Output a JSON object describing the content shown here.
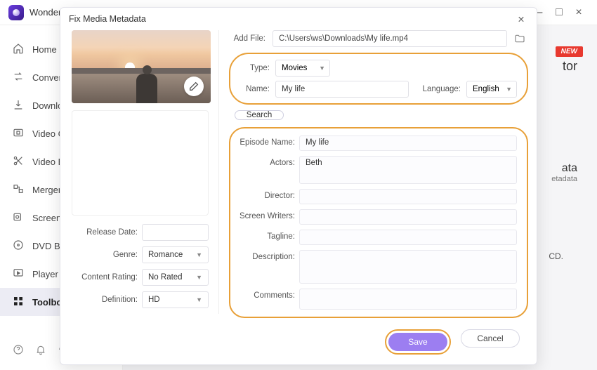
{
  "app": {
    "title_fragment": "Wonder"
  },
  "window_controls": {
    "min": "–",
    "max": "□",
    "close": "×"
  },
  "sidebar": {
    "items": [
      {
        "label": "Home"
      },
      {
        "label": "Converter"
      },
      {
        "label": "Downloader"
      },
      {
        "label": "Video Compressor"
      },
      {
        "label": "Video Editor"
      },
      {
        "label": "Merger"
      },
      {
        "label": "Screen Recorder"
      },
      {
        "label": "DVD Burner"
      },
      {
        "label": "Player"
      },
      {
        "label": "Toolbox"
      }
    ]
  },
  "background": {
    "new_badge": "NEW",
    "section_title_fragment": "tor",
    "section_sub_fragment1": "ata",
    "section_sub_fragment2": "etadata",
    "cd_fragment": "CD."
  },
  "modal": {
    "title": "Fix Media Metadata",
    "add_file_label": "Add File:",
    "add_file_value": "C:\\Users\\ws\\Downloads\\My life.mp4",
    "type_label": "Type:",
    "type_value": "Movies",
    "name_label": "Name:",
    "name_value": "My life",
    "language_label": "Language:",
    "language_value": "English",
    "search": "Search",
    "episode_label": "Episode Name:",
    "episode_value": "My life",
    "actors_label": "Actors:",
    "actors_value": "Beth",
    "director_label": "Director:",
    "writers_label": "Screen Writers:",
    "tagline_label": "Tagline:",
    "description_label": "Description:",
    "comments_label": "Comments:",
    "release_label": "Release Date:",
    "genre_label": "Genre:",
    "genre_value": "Romance",
    "rating_label": "Content Rating:",
    "rating_value": "No Rated",
    "definition_label": "Definition:",
    "definition_value": "HD",
    "save": "Save",
    "cancel": "Cancel"
  }
}
